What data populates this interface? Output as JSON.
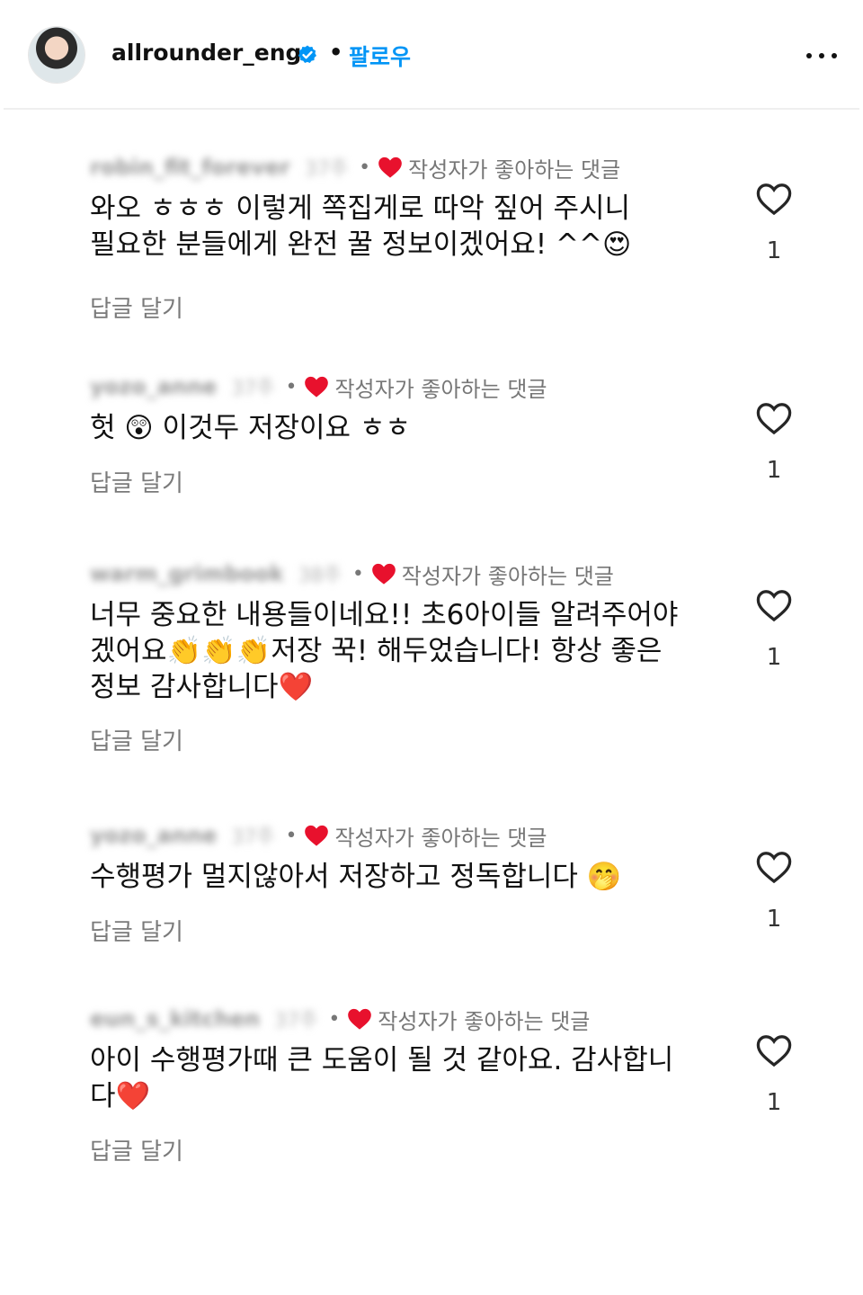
{
  "header": {
    "username": "allrounder_eng",
    "separator": "•",
    "follow_label": "팔로우"
  },
  "liked_by_author_label": "작성자가 좋아하는 댓글",
  "reply_label": "답글 달기",
  "comments": [
    {
      "handle": "robin_fit_forever",
      "time": "37주",
      "text": "와오 ㅎㅎㅎ 이렇게 쪽집게로 따악 짚어 주시니\n필요한 분들에게 완전 꿀 정보이겠어요! ^^😍",
      "likes": "1"
    },
    {
      "handle": "yozo_anne",
      "time": "37주",
      "text": "헛 😲 이것두 저장이요 ㅎㅎ",
      "likes": "1"
    },
    {
      "handle": "warm_grimbook",
      "time": "38주",
      "text": "너무 중요한 내용들이네요!! 초6아이들 알려주어야\n겠어요👏👏👏저장 꾹! 해두었습니다! 항상 좋은\n정보 감사합니다❤️",
      "likes": "1"
    },
    {
      "handle": "yozo_anne",
      "time": "37주",
      "text": "수행평가 멀지않아서 저장하고 정독합니다 🤭",
      "likes": "1"
    },
    {
      "handle": "eun_s_kitchen",
      "time": "37주",
      "text": "아이 수행평가때 큰 도움이 될 것 같아요. 감사합니\n다❤️",
      "likes": "1"
    }
  ],
  "colors": {
    "accent": "#0095f6",
    "heart": "#e8112d",
    "muted": "#777777"
  }
}
